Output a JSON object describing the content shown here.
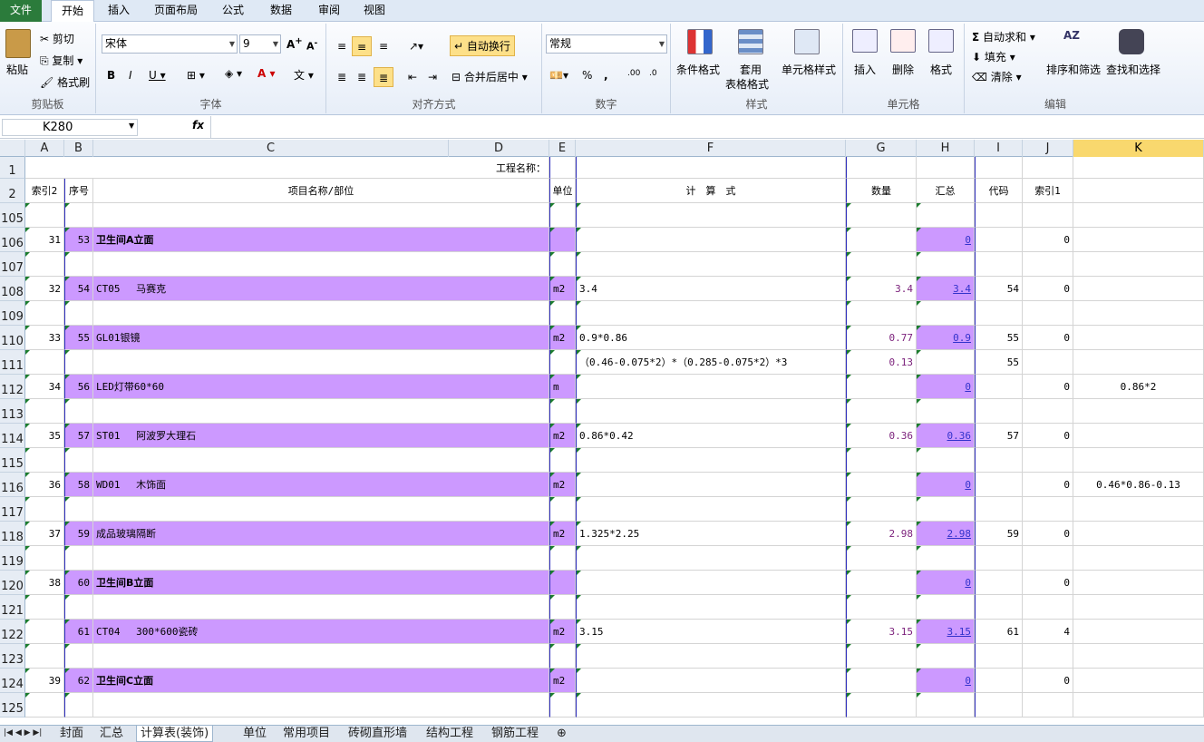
{
  "tabs": [
    "文件",
    "开始",
    "插入",
    "页面布局",
    "公式",
    "数据",
    "审阅",
    "视图"
  ],
  "ribbon": {
    "paste": "粘贴",
    "cut": "剪切",
    "copy": "复制",
    "format_painter": "格式刷",
    "clipboard": "剪贴板",
    "font_name": "宋体",
    "font_size": "9",
    "font_group": "字体",
    "wrap_text": "自动换行",
    "merge_center": "合并后居中",
    "align_group": "对齐方式",
    "number_format": "常规",
    "number_group": "数字",
    "cond_format": "条件格式",
    "table_format_1": "套用",
    "table_format_2": "表格格式",
    "cell_style": "单元格样式",
    "style_group": "样式",
    "insert": "插入",
    "delete": "删除",
    "format": "格式",
    "cells_group": "单元格",
    "autosum": "自动求和",
    "fill": "填充",
    "clear": "清除",
    "sort_filter": "排序和筛选",
    "find_select": "查找和选择",
    "edit_group": "编辑"
  },
  "formula_bar": {
    "name_box": "K280",
    "fx": "fx",
    "formula": ""
  },
  "columns": [
    "A",
    "B",
    "C",
    "D",
    "E",
    "F",
    "G",
    "H",
    "I",
    "J",
    "K"
  ],
  "rows": [
    {
      "n": "1",
      "A": "工程名称：",
      "B": "",
      "C": "",
      "E": "",
      "F": "",
      "G": "",
      "H": "",
      "I": "",
      "J": "",
      "K": ""
    },
    {
      "n": "2",
      "A": "索引2",
      "B": "序号",
      "C": "项目名称/部位",
      "E": "单位",
      "F": "计　算　式",
      "G": "数量",
      "H": "汇总",
      "I": "代码",
      "J": "索引1",
      "K": ""
    },
    {
      "n": "105",
      "A": "",
      "B": "",
      "C": "",
      "E": "",
      "F": "",
      "G": "",
      "H": "",
      "I": "",
      "J": "",
      "K": ""
    },
    {
      "n": "106",
      "A": "31",
      "B": "53",
      "C": "卫生间A立面",
      "E": "",
      "F": "",
      "G": "",
      "H": "0",
      "I": "",
      "J": "0",
      "K": ""
    },
    {
      "n": "107",
      "A": "",
      "B": "",
      "C": "",
      "E": "",
      "F": "",
      "G": "",
      "H": "",
      "I": "",
      "J": "",
      "K": ""
    },
    {
      "n": "108",
      "A": "32",
      "B": "54",
      "C": "CT05　 马赛克",
      "E": "m2",
      "F": "3.4",
      "G": "3.4",
      "H": "3.4",
      "I": "54",
      "J": "0",
      "K": ""
    },
    {
      "n": "109",
      "A": "",
      "B": "",
      "C": "",
      "E": "",
      "F": "",
      "G": "",
      "H": "",
      "I": "",
      "J": "",
      "K": ""
    },
    {
      "n": "110",
      "A": "33",
      "B": "55",
      "C": "GL01银镜",
      "E": "m2",
      "F": "0.9*0.86",
      "G": "0.77",
      "H": "0.9",
      "I": "55",
      "J": "0",
      "K": ""
    },
    {
      "n": "111",
      "A": "",
      "B": "",
      "C": "",
      "E": "",
      "F": "（0.46-0.075*2）*（0.285-0.075*2）*3",
      "G": "0.13",
      "H": "",
      "I": "55",
      "J": "",
      "K": ""
    },
    {
      "n": "112",
      "A": "34",
      "B": "56",
      "C": "LED灯带60*60",
      "E": "m",
      "F": "",
      "G": "",
      "H": "0",
      "I": "",
      "J": "0",
      "K": "0.86*2"
    },
    {
      "n": "113",
      "A": "",
      "B": "",
      "C": "",
      "E": "",
      "F": "",
      "G": "",
      "H": "",
      "I": "",
      "J": "",
      "K": ""
    },
    {
      "n": "114",
      "A": "35",
      "B": "57",
      "C": "ST01　 阿波罗大理石",
      "E": "m2",
      "F": "0.86*0.42",
      "G": "0.36",
      "H": "0.36",
      "I": "57",
      "J": "0",
      "K": ""
    },
    {
      "n": "115",
      "A": "",
      "B": "",
      "C": "",
      "E": "",
      "F": "",
      "G": "",
      "H": "",
      "I": "",
      "J": "",
      "K": ""
    },
    {
      "n": "116",
      "A": "36",
      "B": "58",
      "C": "WD01　 木饰面",
      "E": "m2",
      "F": "",
      "G": "",
      "H": "0",
      "I": "",
      "J": "0",
      "K": "0.46*0.86-0.13"
    },
    {
      "n": "117",
      "A": "",
      "B": "",
      "C": "",
      "E": "",
      "F": "",
      "G": "",
      "H": "",
      "I": "",
      "J": "",
      "K": ""
    },
    {
      "n": "118",
      "A": "37",
      "B": "59",
      "C": "成品玻璃隔断",
      "E": "m2",
      "F": "1.325*2.25",
      "G": "2.98",
      "H": "2.98",
      "I": "59",
      "J": "0",
      "K": ""
    },
    {
      "n": "119",
      "A": "",
      "B": "",
      "C": "",
      "E": "",
      "F": "",
      "G": "",
      "H": "",
      "I": "",
      "J": "",
      "K": ""
    },
    {
      "n": "120",
      "A": "38",
      "B": "60",
      "C": "卫生间B立面",
      "E": "",
      "F": "",
      "G": "",
      "H": "0",
      "I": "",
      "J": "0",
      "K": ""
    },
    {
      "n": "121",
      "A": "",
      "B": "",
      "C": "",
      "E": "",
      "F": "",
      "G": "",
      "H": "",
      "I": "",
      "J": "",
      "K": ""
    },
    {
      "n": "122",
      "A": "",
      "B": "61",
      "C": "CT04　 300*600瓷砖",
      "E": "m2",
      "F": "3.15",
      "G": "3.15",
      "H": "3.15",
      "I": "61",
      "J": "4",
      "K": ""
    },
    {
      "n": "123",
      "A": "",
      "B": "",
      "C": "",
      "E": "",
      "F": "",
      "G": "",
      "H": "",
      "I": "",
      "J": "",
      "K": ""
    },
    {
      "n": "124",
      "A": "39",
      "B": "62",
      "C": "卫生间C立面",
      "E": "m2",
      "F": "",
      "G": "",
      "H": "0",
      "I": "",
      "J": "0",
      "K": ""
    },
    {
      "n": "125",
      "A": "",
      "B": "",
      "C": "",
      "E": "",
      "F": "",
      "G": "",
      "H": "",
      "I": "",
      "J": "",
      "K": ""
    }
  ],
  "purple_rows": [
    "106",
    "108",
    "110",
    "112",
    "114",
    "116",
    "118",
    "120",
    "122",
    "124"
  ],
  "bold_rows": [
    "106",
    "120",
    "124"
  ],
  "sheet_tabs": [
    "封面",
    "汇总",
    "计算表(装饰)",
    "单位",
    "常用项目",
    "砖砌直形墙",
    "结构工程",
    "钢筋工程"
  ],
  "active_sheet": "计算表(装饰)",
  "colors": {
    "purple_fill": "#cc99ff",
    "value_text": "#7a1f7a",
    "link_text": "#3333cc",
    "border_blue": "#2e2ebd",
    "file_tab": "#2b7b3b"
  }
}
